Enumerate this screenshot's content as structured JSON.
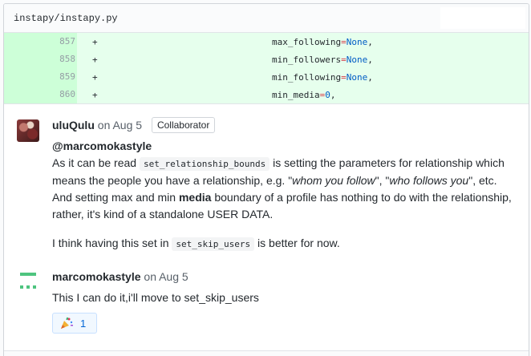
{
  "file": {
    "path": "instapy/instapy.py"
  },
  "diff": {
    "lines": [
      {
        "number": "857",
        "sign": "+",
        "name": "max_following",
        "eq": "=",
        "value": "None",
        "tail": ","
      },
      {
        "number": "858",
        "sign": "+",
        "name": "min_followers",
        "eq": "=",
        "value": "None",
        "tail": ","
      },
      {
        "number": "859",
        "sign": "+",
        "name": "min_following",
        "eq": "=",
        "value": "None",
        "tail": ","
      },
      {
        "number": "860",
        "sign": "+",
        "name": "min_media",
        "eq": "=",
        "value": "0",
        "tail": ","
      }
    ]
  },
  "comments": [
    {
      "author": "uluQulu",
      "date": "on Aug 5",
      "badge": "Collaborator",
      "mention": "@marcomokastyle",
      "p1_a": "As it can be read ",
      "p1_code": "set_relationship_bounds",
      "p1_b": " is setting the parameters for relationship which means the people you have a relationship, e.g. \"",
      "p1_em1": "whom you follow",
      "p1_c": "\", \"",
      "p1_em2": "who follows you",
      "p1_d": "\", etc.",
      "p1_e": "And setting max and min ",
      "p1_strong": "media",
      "p1_f": " boundary of a profile has nothing to do with the relationship, rather, it's kind of a standalone USER DATA.",
      "p2_a": "I think having this set in ",
      "p2_code": "set_skip_users",
      "p2_b": " is better for now."
    },
    {
      "author": "marcomokastyle",
      "date": "on Aug 5",
      "text": "This I can do it,i'll move to set_skip_users",
      "reaction": {
        "emoji": "tada-icon",
        "count": "1"
      }
    }
  ],
  "colors": {
    "added_row": "#e6ffed",
    "added_gutter": "#cdffd8",
    "keyword": "#005cc5",
    "identicon": "#4ec47f",
    "reaction_text": "#0366d6"
  }
}
